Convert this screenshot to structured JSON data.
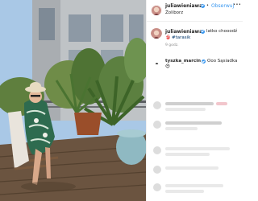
{
  "post": {
    "username": "juliawieniawa",
    "separator": "•",
    "follow_label": "Obserwuj",
    "location": "Żoliborz",
    "more_glyph": "•••"
  },
  "caption": {
    "username": "juliawieniawa",
    "text": "latko chooodź",
    "hashtag": "#tarasik",
    "time": "9 godz."
  },
  "comment": {
    "username": "tyszka_marcin",
    "text": "Ooo Sąsiadka",
    "emoji": "😍"
  },
  "colors": {
    "link": "#3897f0",
    "verified": "#3897f0",
    "hashtag": "#003569",
    "text": "#262626",
    "muted": "#8e8e8e"
  }
}
